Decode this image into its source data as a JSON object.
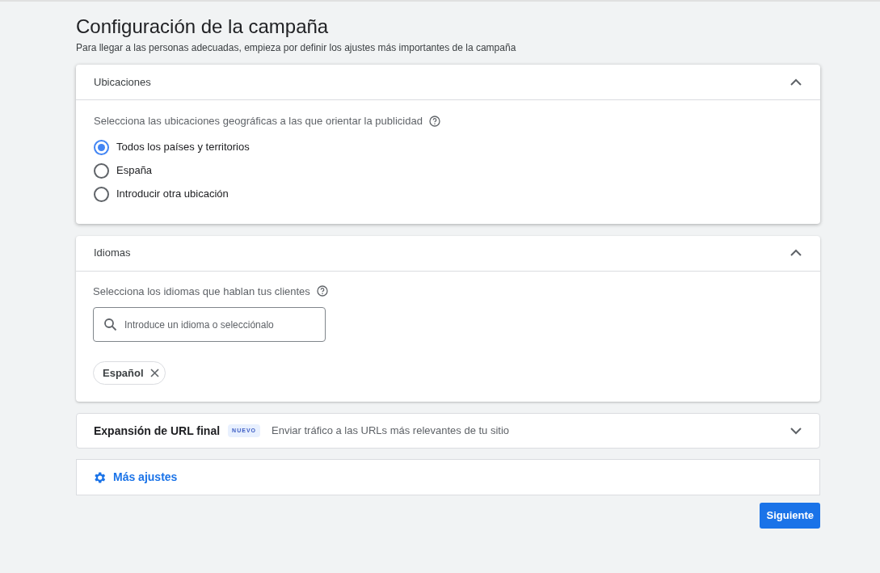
{
  "page": {
    "title": "Configuración de la campaña",
    "subtitle": "Para llegar a las personas adecuadas, empieza por definir los ajustes más importantes de la campaña"
  },
  "locations": {
    "title": "Ubicaciones",
    "expanded": true,
    "prompt": "Selecciona las ubicaciones geográficas a las que orientar la publicidad",
    "options": [
      {
        "label": "Todos los países y territorios",
        "selected": true
      },
      {
        "label": "España",
        "selected": false
      },
      {
        "label": "Introducir otra ubicación",
        "selected": false
      }
    ]
  },
  "languages": {
    "title": "Idiomas",
    "expanded": true,
    "prompt": "Selecciona los idiomas que hablan tus clientes",
    "search": {
      "placeholder": "Introduce un idioma o selecciónalo"
    },
    "chips": [
      "Español"
    ]
  },
  "url_expansion": {
    "title": "Expansión de URL final",
    "badge": "NUEVO",
    "description": "Enviar tráfico a las URLs más relevantes de tu sitio",
    "expanded": false
  },
  "more_settings": {
    "label": "Más ajustes"
  },
  "next_button": "Siguiente"
}
